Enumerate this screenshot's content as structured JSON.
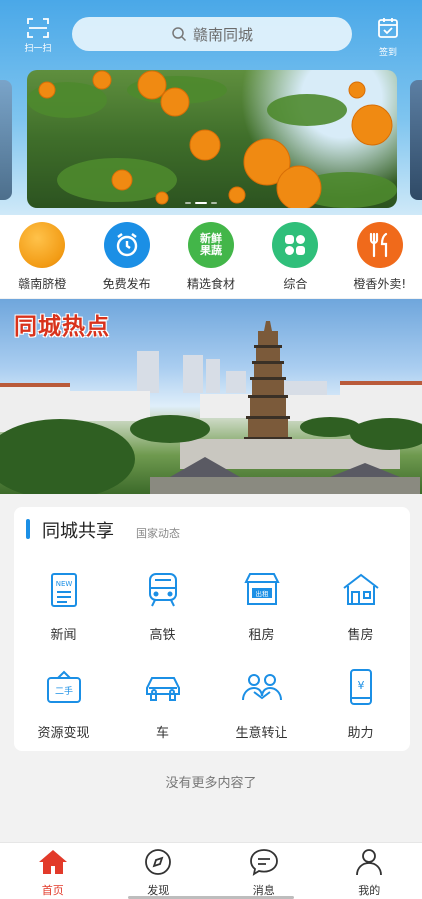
{
  "header": {
    "scan_label": "扫一扫",
    "search_placeholder": "赣南同城",
    "signin_label": "签到"
  },
  "banner": {
    "slide_count": 3,
    "active_slide": 1
  },
  "categories": [
    {
      "label": "赣南脐橙",
      "icon": "orange-icon",
      "color": "#f29b14"
    },
    {
      "label": "免费发布",
      "icon": "alarm-clock-icon",
      "color": "#1b8fe5"
    },
    {
      "label": "精选食材",
      "icon": "fresh-produce-icon",
      "color": "#43b649",
      "icon_text": "新鲜\n果蔬"
    },
    {
      "label": "综合",
      "icon": "grid-icon",
      "color": "#2fbf7a"
    },
    {
      "label": "橙香外卖!",
      "icon": "fork-knife-icon",
      "color": "#f06a1b"
    }
  ],
  "hotspot": {
    "title": "同城热点"
  },
  "shared": {
    "title": "同城共享",
    "subtitle": "国家动态",
    "items": [
      {
        "label": "新闻",
        "icon": "news-icon"
      },
      {
        "label": "高铁",
        "icon": "train-icon"
      },
      {
        "label": "租房",
        "icon": "rent-shop-icon"
      },
      {
        "label": "售房",
        "icon": "house-icon"
      },
      {
        "label": "资源变现",
        "icon": "secondhand-sign-icon"
      },
      {
        "label": "车",
        "icon": "car-icon"
      },
      {
        "label": "生意转让",
        "icon": "handshake-icon"
      },
      {
        "label": "助力",
        "icon": "phone-yuan-icon"
      }
    ]
  },
  "footer_note": "没有更多内容了",
  "nav": {
    "active": "home",
    "items": [
      {
        "label": "首页",
        "icon": "home-icon"
      },
      {
        "label": "发现",
        "icon": "compass-icon"
      },
      {
        "label": "消息",
        "icon": "message-icon"
      },
      {
        "label": "我的",
        "icon": "user-icon"
      }
    ]
  },
  "colors": {
    "accent": "#1b8fe5",
    "nav_active": "#e23a2a"
  }
}
